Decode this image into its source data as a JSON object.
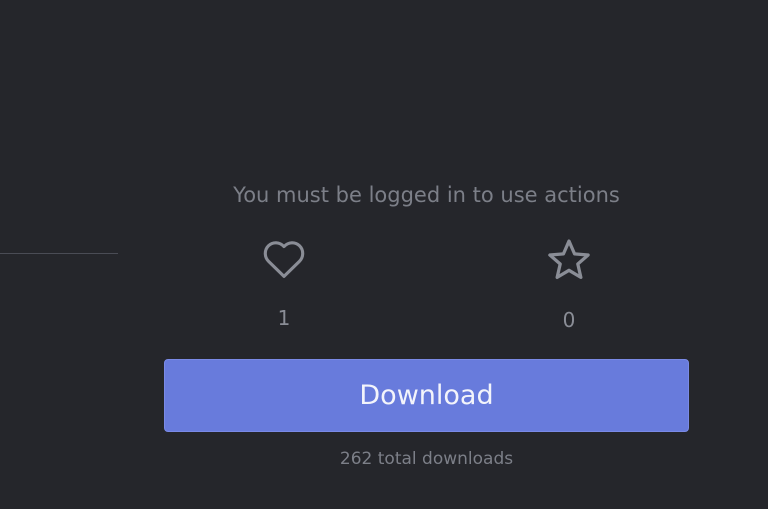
{
  "login_message": "You must be logged in to use actions",
  "actions": {
    "like": {
      "icon": "heart-icon",
      "count": "1"
    },
    "star": {
      "icon": "star-icon",
      "count": "0"
    }
  },
  "download": {
    "label": "Download",
    "total_text": "262 total downloads"
  },
  "colors": {
    "background": "#25262b",
    "accent": "#687bdc",
    "muted_text": "#7c7f88",
    "icon": "#8a8d96"
  }
}
